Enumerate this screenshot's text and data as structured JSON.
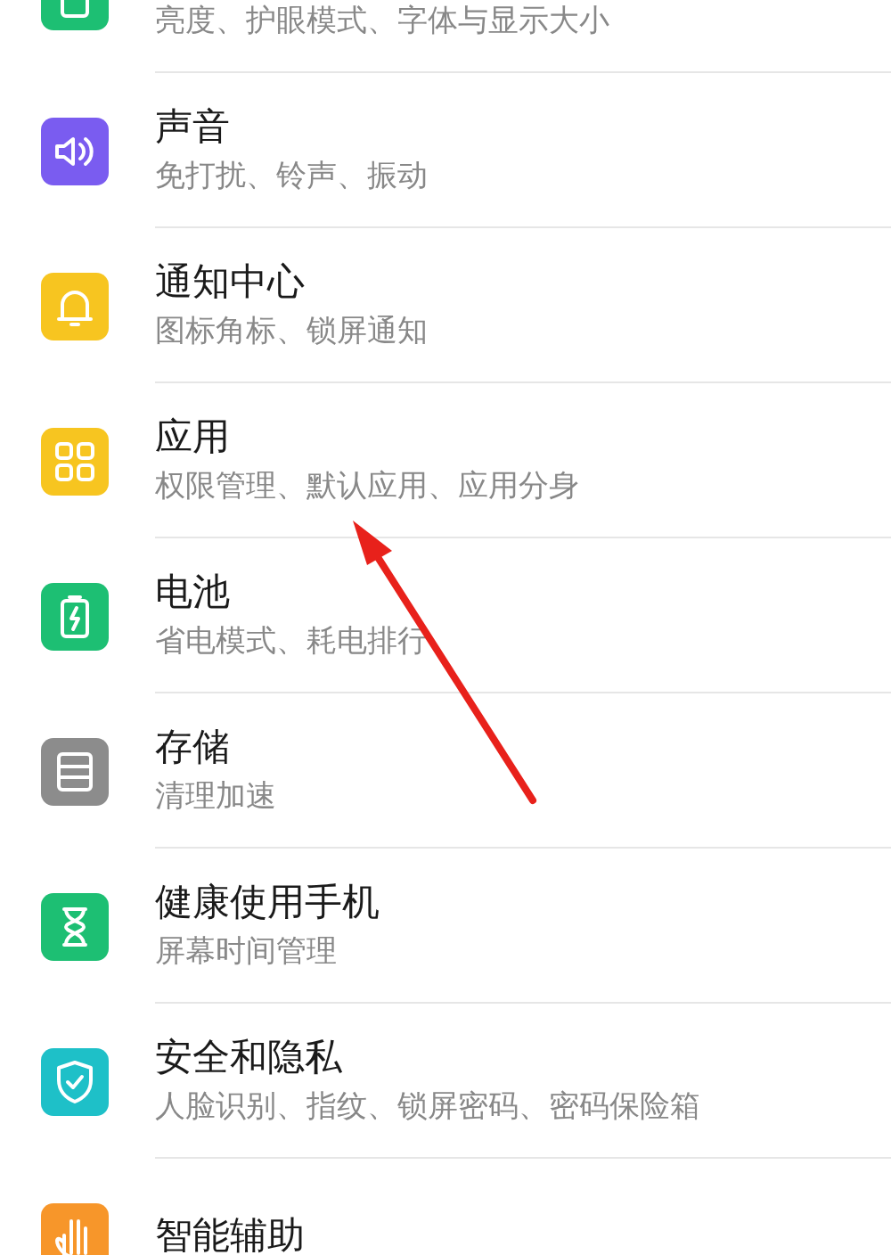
{
  "settings": [
    {
      "kind": "display",
      "color": "#1dbf73",
      "subtitle": "亮度、护眼模式、字体与显示大小"
    },
    {
      "kind": "sound",
      "color": "#7a5cf0",
      "title": "声音",
      "subtitle": "免打扰、铃声、振动"
    },
    {
      "kind": "bell",
      "color": "#f7c520",
      "title": "通知中心",
      "subtitle": "图标角标、锁屏通知"
    },
    {
      "kind": "grid",
      "color": "#f7c520",
      "title": "应用",
      "subtitle": "权限管理、默认应用、应用分身"
    },
    {
      "kind": "battery",
      "color": "#1dbf73",
      "title": "电池",
      "subtitle": "省电模式、耗电排行"
    },
    {
      "kind": "storage",
      "color": "#8c8c8c",
      "title": "存储",
      "subtitle": "清理加速"
    },
    {
      "kind": "hourglass",
      "color": "#1dbf73",
      "title": "健康使用手机",
      "subtitle": "屏幕时间管理"
    },
    {
      "kind": "shield",
      "color": "#1ec0c8",
      "title": "安全和隐私",
      "subtitle": "人脸识别、指纹、锁屏密码、密码保险箱"
    },
    {
      "kind": "hand",
      "color": "#f7962a",
      "title": "智能辅助"
    }
  ]
}
